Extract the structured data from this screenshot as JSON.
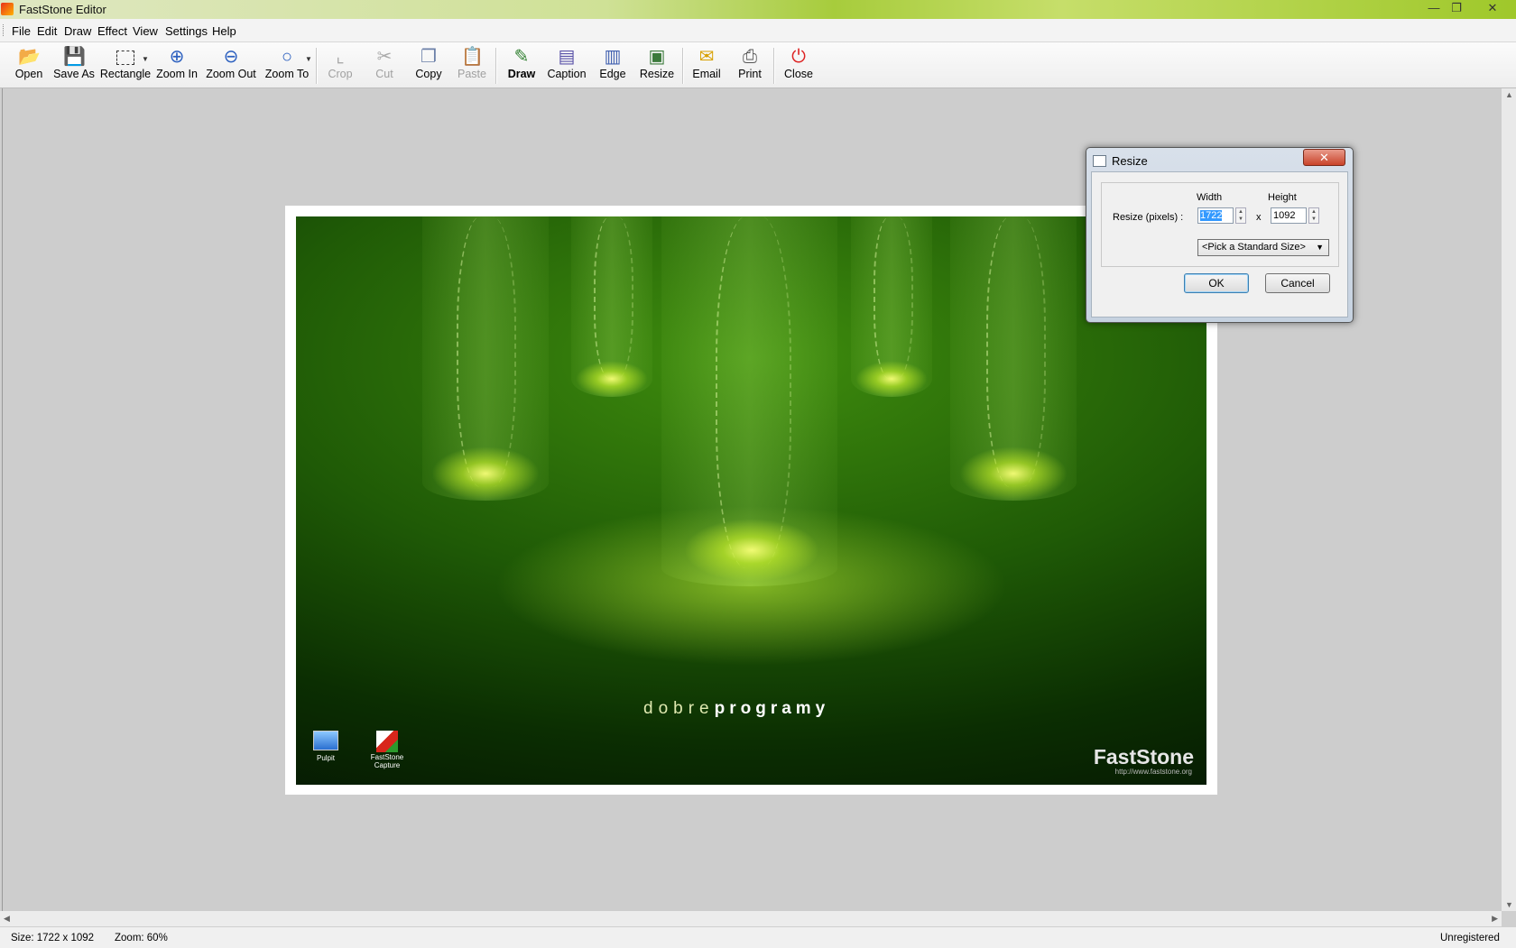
{
  "window": {
    "title": "FastStone Editor",
    "buttons": [
      "minimize",
      "restore",
      "close"
    ]
  },
  "menu": [
    "File",
    "Edit",
    "Draw",
    "Effect",
    "View",
    "Settings",
    "Help"
  ],
  "toolbar": {
    "open": "Open",
    "save_as": "Save As",
    "rectangle": "Rectangle",
    "zoom_in": "Zoom In",
    "zoom_out": "Zoom Out",
    "zoom_to": "Zoom To",
    "crop": "Crop",
    "cut": "Cut",
    "copy": "Copy",
    "paste": "Paste",
    "draw": "Draw",
    "caption": "Caption",
    "edge": "Edge",
    "resize": "Resize",
    "email": "Email",
    "print": "Print",
    "close": "Close"
  },
  "image": {
    "wallpaper_text_light": "dobre",
    "wallpaper_text_bold": "programy",
    "desktop_icons": [
      "Pulpit",
      "FastStone Capture"
    ],
    "brand": "FastStone",
    "brand_url": "http://www.faststone.org"
  },
  "dialog": {
    "title": "Resize",
    "width_label": "Width",
    "height_label": "Height",
    "resize_label": "Resize (pixels) :",
    "width_value": "1722",
    "height_value": "1092",
    "x_label": "x",
    "standard_size": "<Pick a Standard Size>",
    "ok": "OK",
    "cancel": "Cancel"
  },
  "status": {
    "size": "Size: 1722 x 1092",
    "zoom": "Zoom: 60%",
    "registration": "Unregistered"
  }
}
